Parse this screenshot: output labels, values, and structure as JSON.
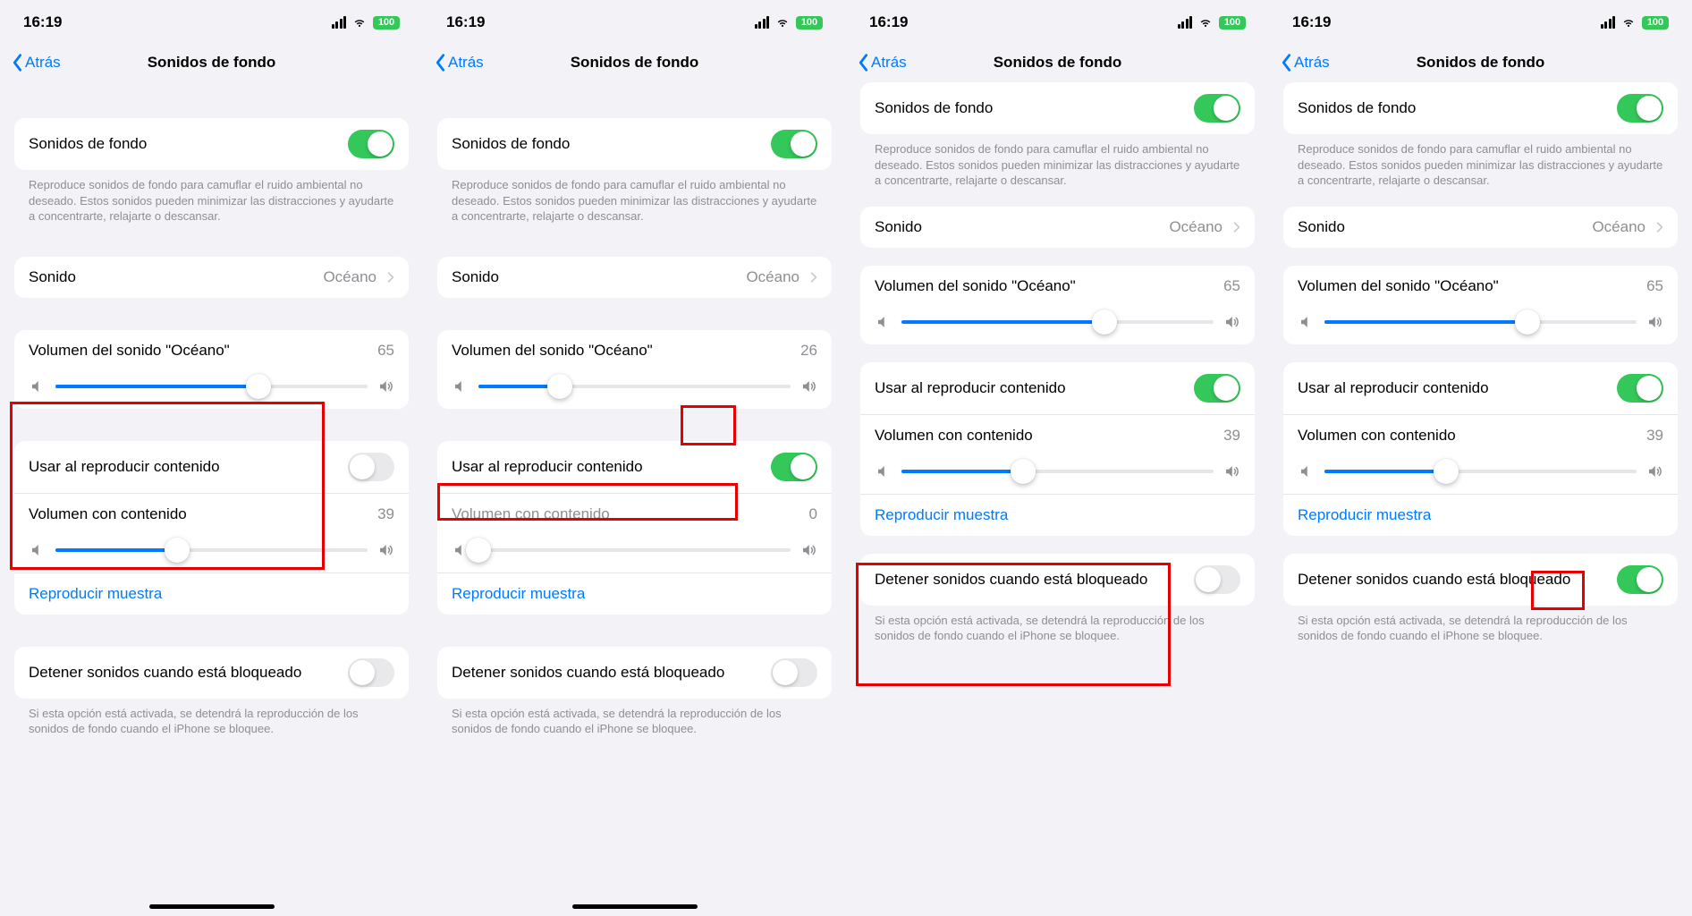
{
  "status": {
    "time": "16:19",
    "battery_text": "100"
  },
  "nav": {
    "back": "Atrás",
    "title": "Sonidos de fondo"
  },
  "common": {
    "main_toggle_label": "Sonidos de fondo",
    "main_description": "Reproduce sonidos de fondo para camuflar el ruido ambiental no deseado. Estos sonidos pueden minimizar las distracciones y ayudarte a concentrarte, relajarte o descansar.",
    "sound_label": "Sonido",
    "sound_value": "Océano",
    "sound_volume_label": "Volumen del sonido \"Océano\"",
    "use_media_label": "Usar al reproducir contenido",
    "media_volume_label": "Volumen con contenido",
    "play_sample": "Reproducir muestra",
    "stop_locked_label": "Detener sonidos cuando está bloqueado",
    "stop_locked_desc": "Si esta opción está activada, se detendrá la reproducción de los sonidos de fondo cuando el iPhone se bloquee."
  },
  "panels": [
    {
      "sound_volume": 65,
      "use_media_on": false,
      "media_volume": 39,
      "media_volume_dim": false,
      "stop_locked_on": false,
      "compact": false
    },
    {
      "sound_volume": 26,
      "use_media_on": true,
      "media_volume": 0,
      "media_volume_dim": true,
      "stop_locked_on": false,
      "compact": false
    },
    {
      "sound_volume": 65,
      "use_media_on": true,
      "media_volume": 39,
      "media_volume_dim": false,
      "stop_locked_on": false,
      "compact": true
    },
    {
      "sound_volume": 65,
      "use_media_on": true,
      "media_volume": 39,
      "media_volume_dim": false,
      "stop_locked_on": true,
      "compact": true
    }
  ]
}
